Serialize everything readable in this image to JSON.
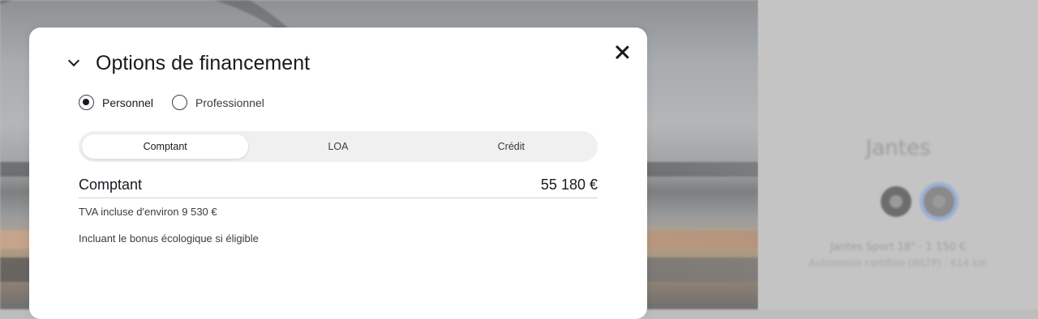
{
  "modal": {
    "title": "Options de financement",
    "radios": [
      {
        "label": "Personnel",
        "checked": true
      },
      {
        "label": "Professionnel",
        "checked": false
      }
    ],
    "tabs": [
      {
        "label": "Comptant",
        "active": true
      },
      {
        "label": "LOA",
        "active": false
      },
      {
        "label": "Crédit",
        "active": false
      }
    ],
    "price": {
      "label": "Comptant",
      "value": "55 180 €"
    },
    "notes": [
      "TVA incluse d'environ 9 530 €",
      "Incluant le bonus écologique si éligible"
    ]
  },
  "background_panel": {
    "title": "Jantes",
    "line1": "Jantes Sport 18\" · 1 150 €",
    "line2": "Autonomie certifiée (WLTP) : 614 km"
  },
  "colors": {
    "text": "#171a20",
    "tab_track": "#f0f0f0",
    "overlay_panel": "#c4c4c4"
  },
  "icons": [
    "close-icon",
    "chevron-down-icon",
    "wheel-icon"
  ]
}
